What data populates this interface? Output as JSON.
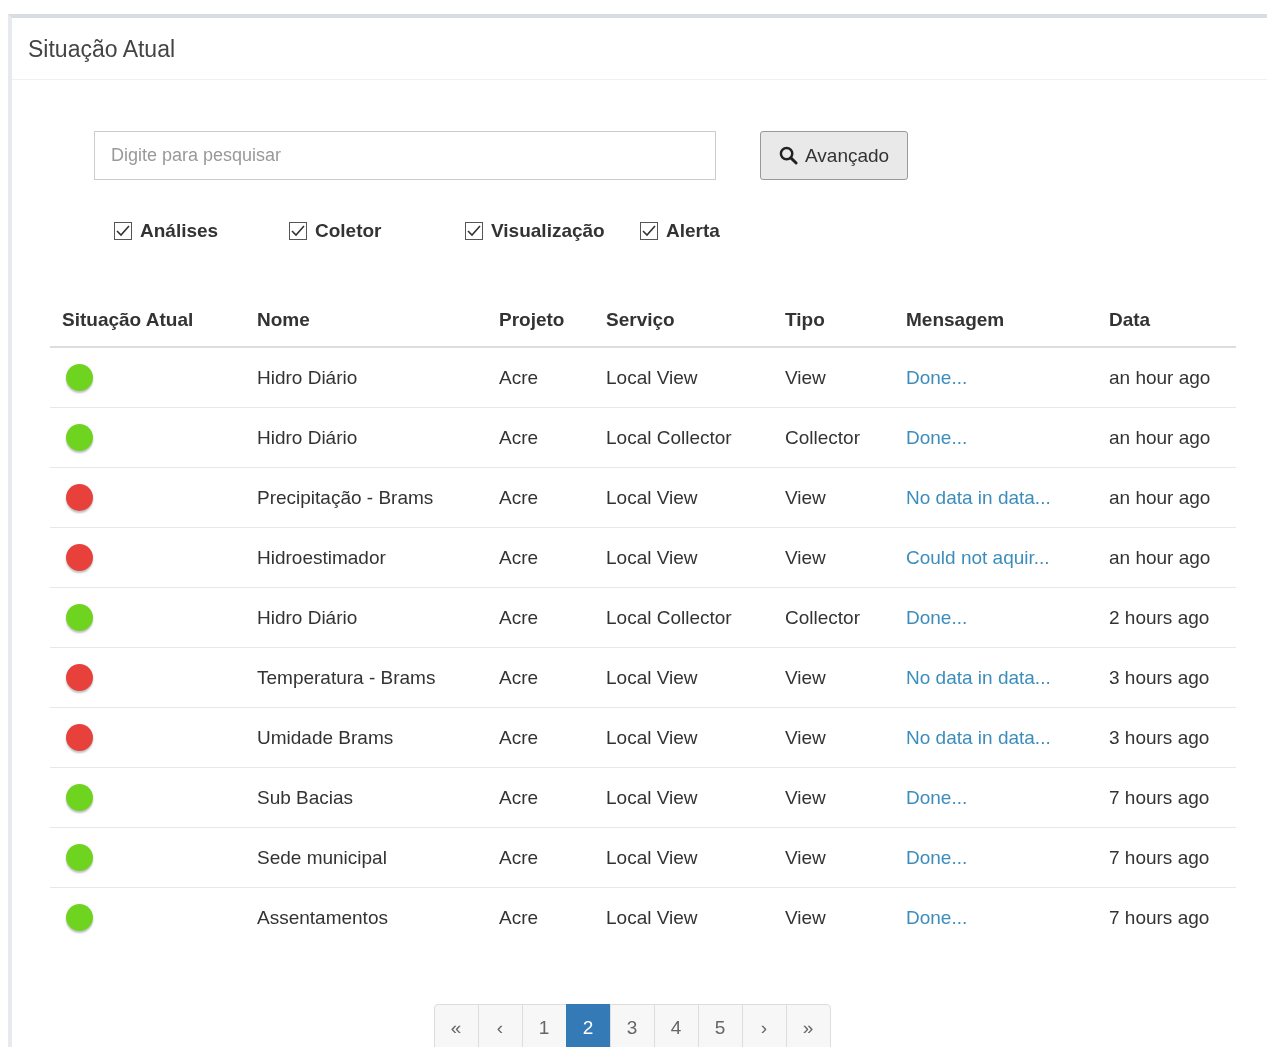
{
  "panel": {
    "title": "Situação Atual"
  },
  "search": {
    "placeholder": "Digite para pesquisar",
    "button": "Avançado"
  },
  "filters": [
    {
      "label": "Análises",
      "checked": true
    },
    {
      "label": "Coletor",
      "checked": true
    },
    {
      "label": "Visualização",
      "checked": true
    },
    {
      "label": "Alerta",
      "checked": true
    }
  ],
  "table": {
    "columns": [
      "Situação Atual",
      "Nome",
      "Projeto",
      "Serviço",
      "Tipo",
      "Mensagem",
      "Data"
    ],
    "rows": [
      {
        "color": "#6fd41f",
        "nome": "Hidro Diário",
        "projeto": "Acre",
        "servico": "Local View",
        "tipo": "View",
        "mensagem": "Done...",
        "data": "an hour ago"
      },
      {
        "color": "#6fd41f",
        "nome": "Hidro Diário",
        "projeto": "Acre",
        "servico": "Local Collector",
        "tipo": "Collector",
        "mensagem": "Done...",
        "data": "an hour ago"
      },
      {
        "color": "#e8413c",
        "nome": "Precipitação - Brams",
        "projeto": "Acre",
        "servico": "Local View",
        "tipo": "View",
        "mensagem": "No data in data...",
        "data": "an hour ago"
      },
      {
        "color": "#e8413c",
        "nome": "Hidroestimador",
        "projeto": "Acre",
        "servico": "Local View",
        "tipo": "View",
        "mensagem": "Could not aquir...",
        "data": "an hour ago"
      },
      {
        "color": "#6fd41f",
        "nome": "Hidro Diário",
        "projeto": "Acre",
        "servico": "Local Collector",
        "tipo": "Collector",
        "mensagem": "Done...",
        "data": "2 hours ago"
      },
      {
        "color": "#e8413c",
        "nome": "Temperatura - Brams",
        "projeto": "Acre",
        "servico": "Local View",
        "tipo": "View",
        "mensagem": "No data in data...",
        "data": "3 hours ago"
      },
      {
        "color": "#e8413c",
        "nome": "Umidade Brams",
        "projeto": "Acre",
        "servico": "Local View",
        "tipo": "View",
        "mensagem": "No data in data...",
        "data": "3 hours ago"
      },
      {
        "color": "#6fd41f",
        "nome": "Sub Bacias",
        "projeto": "Acre",
        "servico": "Local View",
        "tipo": "View",
        "mensagem": "Done...",
        "data": "7 hours ago"
      },
      {
        "color": "#6fd41f",
        "nome": "Sede municipal",
        "projeto": "Acre",
        "servico": "Local View",
        "tipo": "View",
        "mensagem": "Done...",
        "data": "7 hours ago"
      },
      {
        "color": "#6fd41f",
        "nome": "Assentamentos",
        "projeto": "Acre",
        "servico": "Local View",
        "tipo": "View",
        "mensagem": "Done...",
        "data": "7 hours ago"
      }
    ]
  },
  "pagination": [
    {
      "label": "«",
      "selected": false
    },
    {
      "label": "‹",
      "selected": false
    },
    {
      "label": "1",
      "selected": false
    },
    {
      "label": "2",
      "selected": true
    },
    {
      "label": "3",
      "selected": false
    },
    {
      "label": "4",
      "selected": false
    },
    {
      "label": "5",
      "selected": false
    },
    {
      "label": "›",
      "selected": false
    },
    {
      "label": "»",
      "selected": false
    }
  ]
}
